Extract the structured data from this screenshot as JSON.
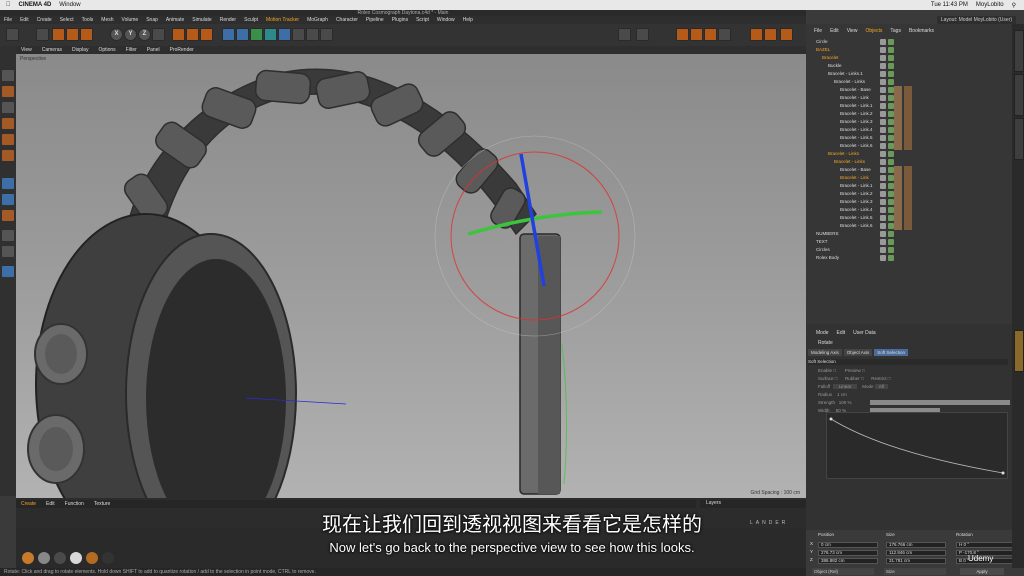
{
  "mac_menubar": {
    "app": "CINEMA 4D",
    "items": [
      "Window"
    ],
    "time": "Tue 11:43 PM",
    "user": "MoyLobito"
  },
  "document_title": "Rolex Cosmograph Daytona.c4d * - Main",
  "layout": "Layout:  Model MoyLobito (User)",
  "c4d_menu": [
    "File",
    "Edit",
    "Create",
    "Select",
    "Tools",
    "Mesh",
    "Volume",
    "Snap",
    "Animate",
    "Simulate",
    "Render",
    "Sculpt",
    "Motion Tracker",
    "MoGraph",
    "Character",
    "Pipeline",
    "Plugins",
    "Script",
    "Window",
    "Help"
  ],
  "viewport_menu": [
    "View",
    "Cameras",
    "Display",
    "Options",
    "Filter",
    "Panel",
    "ProRender"
  ],
  "viewport_label": "Perspective",
  "grid_spacing": "Grid Spacing : 100 cm",
  "timeline_menu": [
    "Create",
    "Edit",
    "Function",
    "Texture"
  ],
  "layers_label": "Layers",
  "lander_label": "LANDER",
  "status_text": "Rotate: Click and drag to rotate elements. Hold down SHIFT to add to quantize rotation / add to the selection in point mode, CTRL to remove.",
  "object_manager": {
    "menu": [
      "File",
      "Edit",
      "View",
      "Objects",
      "Tags",
      "Bookmarks"
    ],
    "rows": [
      {
        "name": "Circle",
        "indent": 0,
        "style": "normal"
      },
      {
        "name": "BAZEL",
        "indent": 0,
        "style": "orange"
      },
      {
        "name": "Bracelet",
        "indent": 1,
        "style": "orange"
      },
      {
        "name": "Buckle",
        "indent": 2,
        "style": "normal"
      },
      {
        "name": "Bracelet - Links.1",
        "indent": 2,
        "style": "normal"
      },
      {
        "name": "Bracelet - Links",
        "indent": 3,
        "style": "normal"
      },
      {
        "name": "Bracelet - Base",
        "indent": 4,
        "style": "normal"
      },
      {
        "name": "Bracelet - Link",
        "indent": 4,
        "style": "normal"
      },
      {
        "name": "Bracelet - Link.1",
        "indent": 4,
        "style": "normal"
      },
      {
        "name": "Bracelet - Link.2",
        "indent": 4,
        "style": "normal"
      },
      {
        "name": "Bracelet - Link.3",
        "indent": 4,
        "style": "normal"
      },
      {
        "name": "Bracelet - Link.4",
        "indent": 4,
        "style": "normal"
      },
      {
        "name": "Bracelet - Link.5",
        "indent": 4,
        "style": "normal"
      },
      {
        "name": "Bracelet - Link.6",
        "indent": 4,
        "style": "normal"
      },
      {
        "name": "Bracelet - Links",
        "indent": 2,
        "style": "orange"
      },
      {
        "name": "Bracelet - Links",
        "indent": 3,
        "style": "orange"
      },
      {
        "name": "Bracelet - Base",
        "indent": 4,
        "style": "normal"
      },
      {
        "name": "Bracelet - Link",
        "indent": 4,
        "style": "orange"
      },
      {
        "name": "Bracelet - Link.1",
        "indent": 4,
        "style": "normal"
      },
      {
        "name": "Bracelet - Link.2",
        "indent": 4,
        "style": "normal"
      },
      {
        "name": "Bracelet - Link.3",
        "indent": 4,
        "style": "normal"
      },
      {
        "name": "Bracelet - Link.4",
        "indent": 4,
        "style": "normal"
      },
      {
        "name": "Bracelet - Link.5",
        "indent": 4,
        "style": "normal"
      },
      {
        "name": "Bracelet - Link.6",
        "indent": 4,
        "style": "normal"
      },
      {
        "name": "NUMBERS",
        "indent": 0,
        "style": "normal"
      },
      {
        "name": "TEXT",
        "indent": 0,
        "style": "normal"
      },
      {
        "name": "Circles",
        "indent": 0,
        "style": "normal"
      },
      {
        "name": "Rolex Body",
        "indent": 0,
        "style": "normal"
      }
    ]
  },
  "attribute_manager": {
    "menu": [
      "Mode",
      "Edit",
      "User Data"
    ],
    "tool": "Rotate",
    "tabs": [
      "Modeling Axis",
      "Object Axis",
      "Soft Selection"
    ],
    "section": "Soft Selection",
    "fields": [
      {
        "label": "Enable",
        "label2": "Preview"
      },
      {
        "label": "Surface",
        "label2": "Rubber",
        "label3": "Restrict"
      },
      {
        "label": "Falloff",
        "value": "Linear",
        "label2": "Mode",
        "value2": "All"
      },
      {
        "label": "Radius",
        "value": "1 cm"
      },
      {
        "label": "Strength",
        "value": "100 %"
      },
      {
        "label": "Width",
        "value": "50 %"
      }
    ]
  },
  "coordinates": {
    "headers": [
      "Position",
      "Size",
      "Rotation"
    ],
    "rows": [
      {
        "axis": "X",
        "pos": "0 cm",
        "size": "176.766 cm",
        "rot": "H  0 °"
      },
      {
        "axis": "Y",
        "pos": "276.73 cm",
        "size": "112.846 cm",
        "rot": "P  -170.8 °"
      },
      {
        "axis": "Z",
        "pos": "386.882 cm",
        "size": "31.781 cm",
        "rot": "B  0 °"
      }
    ],
    "mode1": "Object (Rel)",
    "mode2": "Size",
    "apply": "Apply"
  },
  "subtitles": {
    "cn": "现在让我们回到透视视图来看看它是怎样的",
    "en": "Now let's go back to the perspective view to see how this looks."
  },
  "watermark": "Udemy",
  "colors": {
    "accent": "#f5a623",
    "axis_x": "#e03030",
    "axis_y": "#3cc43c",
    "axis_z": "#2040e0"
  }
}
